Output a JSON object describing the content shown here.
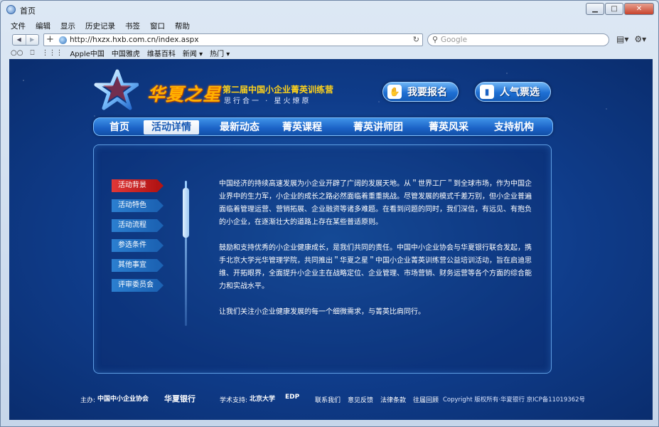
{
  "browser": {
    "title": "首页",
    "menu": [
      "文件",
      "编辑",
      "显示",
      "历史记录",
      "书签",
      "窗口",
      "帮助"
    ],
    "url": "http://hxzx.hxb.com.cn/index.aspx",
    "search_placeholder": "Google",
    "bookmarks": [
      "Apple中国",
      "中国雅虎",
      "维基百科",
      "新闻 ▾",
      "热门 ▾"
    ]
  },
  "header": {
    "logo_title": "华夏之星",
    "logo_subtitle": "第二届中国小企业菁英训练营",
    "logo_slogan": "思行合一 · 星火燎原",
    "signup_button": "我要报名",
    "vote_button": "人气票选"
  },
  "nav": {
    "items": [
      "首页",
      "活动详情",
      "最新动态",
      "菁英课程",
      "菁英讲师团",
      "菁英风采",
      "支持机构"
    ],
    "active_index": 1
  },
  "sidebar": {
    "items": [
      "活动背景",
      "活动特色",
      "活动流程",
      "参选条件",
      "其他事宜",
      "评审委员会"
    ],
    "active_index": 0
  },
  "content": {
    "paragraphs": [
      "中国经济的持续高速发展为小企业开辟了广阔的发展天地。从＂世界工厂＂到全球市场，作为中国企业界中的生力军，小企业的成长之路必然面临着重重挑战。尽管发展的模式千差万别，但小企业普遍面临着管理运营、营销拓展、企业融资等诸多难题。在看到问题的同时，我们深信，有远见、有抱负的小企业，在逐渐壮大的道路上存在某些普适原则。",
      "鼓励和支持优秀的小企业健康成长，是我们共同的责任。中国中小企业协会与华夏银行联合发起，携手北京大学光华管理学院，共同推出＂华夏之星＂中国小企业菁英训练营公益培训活动，旨在启迪思维、开拓眼界，全面提升小企业主在战略定位、企业管理、市场营销、财务运营等各个方面的综合能力和实战水平。",
      "让我们关注小企业健康发展的每一个细微需求，与菁英比肩同行。"
    ]
  },
  "footer": {
    "host_label": "主办:",
    "org1": "中国中小企业协会",
    "org2": "华夏银行",
    "academic_label": "学术支持:",
    "org3": "北京大学",
    "org4": "EDP",
    "links": [
      "联系我们",
      "意见反馈",
      "法律条款",
      "往届回顾"
    ],
    "copyright": "Copyright 版权所有·华夏银行  京ICP备11019362号"
  },
  "colors": {
    "page_bg": "#0f3c8a",
    "nav_bar": "#1b62c6",
    "accent_gold": "#ffb100",
    "active_side": "#c41e1e"
  }
}
